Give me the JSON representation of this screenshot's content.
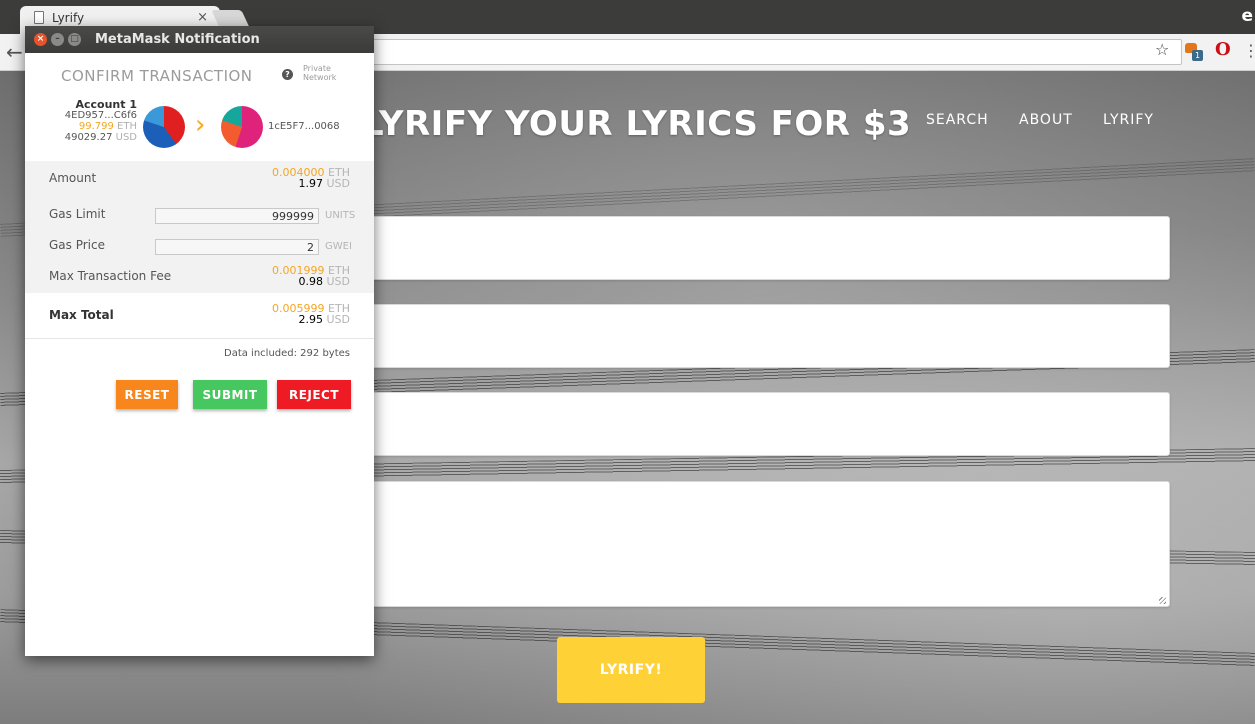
{
  "browser": {
    "tab_title": "Lyrify",
    "tab_close": "×",
    "back_glyph": "←",
    "star_glyph": "☆",
    "menu_glyph": "⋮",
    "metamask_badge": "1",
    "opera_glyph": "O",
    "corner_letter": "e"
  },
  "site": {
    "hero_title": "LYRIFY YOUR LYRICS FOR $3",
    "nav": [
      "SEARCH",
      "ABOUT",
      "LYRIFY"
    ],
    "submit_label": "LYRIFY!",
    "colors": {
      "accent": "#fed136"
    }
  },
  "metamask": {
    "window_title": "MetaMask Notification",
    "header": "CONFIRM TRANSACTION",
    "network_label": [
      "Private",
      "Network"
    ],
    "from": {
      "name": "Account 1",
      "address": "4ED957...C6f6",
      "eth_balance": "99.799",
      "eth_unit": "ETH",
      "usd_balance": "49029.27",
      "usd_unit": "USD"
    },
    "to_address": "1cE5F7...0068",
    "amount": {
      "label": "Amount",
      "eth": "0.004000",
      "eth_unit": "ETH",
      "usd": "1.97",
      "usd_unit": "USD"
    },
    "gas_limit": {
      "label": "Gas Limit",
      "value": "999999",
      "unit": "UNITS"
    },
    "gas_price": {
      "label": "Gas Price",
      "value": "2",
      "unit": "GWEI"
    },
    "max_fee": {
      "label": "Max Transaction Fee",
      "eth": "0.001999",
      "eth_unit": "ETH",
      "usd": "0.98",
      "usd_unit": "USD"
    },
    "max_total": {
      "label": "Max Total",
      "eth": "0.005999",
      "eth_unit": "ETH",
      "usd": "2.95",
      "usd_unit": "USD"
    },
    "data_included": "Data included: 292 bytes",
    "buttons": {
      "reset": "RESET",
      "submit": "SUBMIT",
      "reject": "REJECT"
    },
    "colors": {
      "orange": "#f5a623",
      "reset": "#f7861c",
      "submit": "#47c760",
      "reject": "#ee1b24"
    }
  }
}
